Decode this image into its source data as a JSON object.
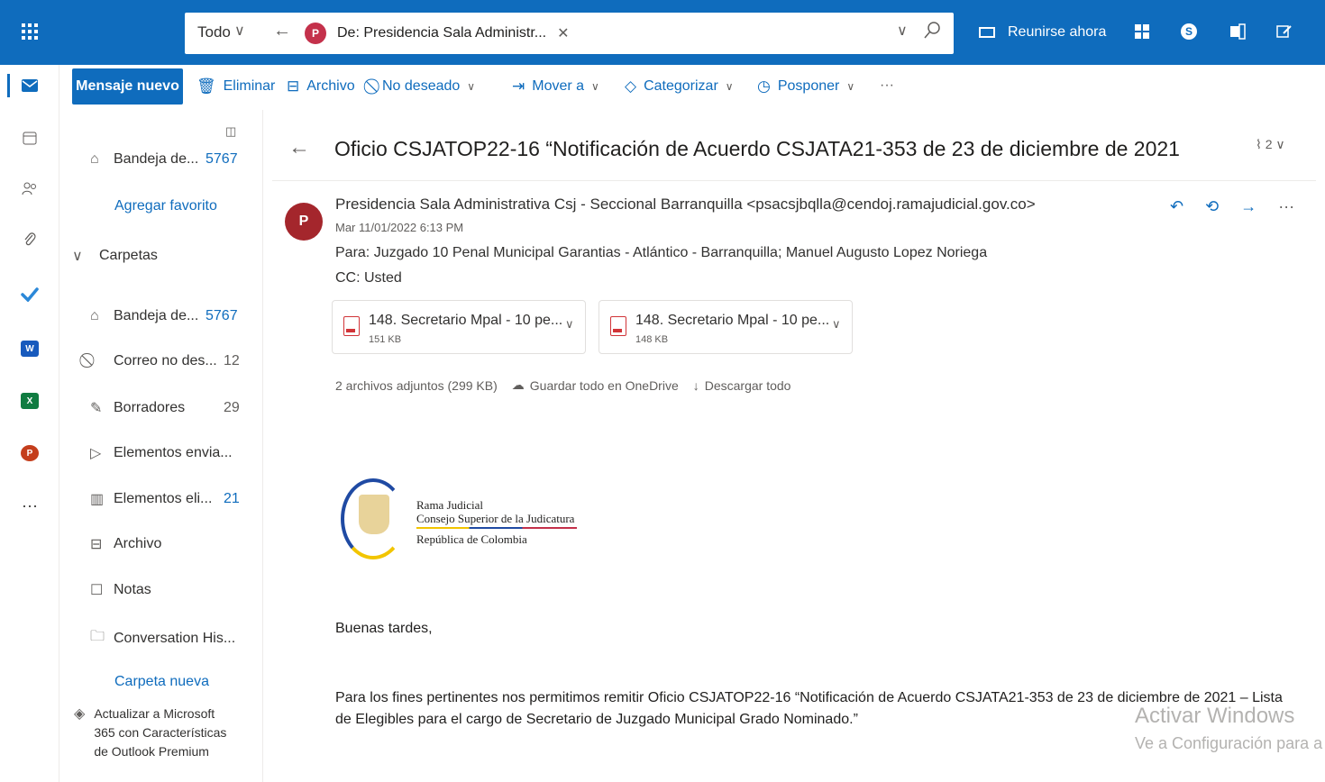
{
  "topbar": {
    "scope": "Todo",
    "chip_initial": "P",
    "chip_label": "De: Presidencia Sala Administr...",
    "meet_now": "Reunirse ahora",
    "accent": "#0f6cbd"
  },
  "commands": {
    "new_message": "Mensaje nuevo",
    "delete": "Eliminar",
    "archive": "Archivo",
    "junk": "No deseado",
    "move_to": "Mover a",
    "categorize": "Categorizar",
    "snooze": "Posponer",
    "more": "···"
  },
  "folders": {
    "favorite_inbox": {
      "label": "Bandeja de...",
      "count": "5767"
    },
    "add_favorite": "Agregar favorito",
    "folders_header": "Carpetas",
    "items": [
      {
        "label": "Bandeja de...",
        "count": "5767"
      },
      {
        "label": "Correo no des...",
        "count": "12"
      },
      {
        "label": "Borradores",
        "count": "29"
      },
      {
        "label": "Elementos envia...",
        "count": ""
      },
      {
        "label": "Elementos eli...",
        "count": "21"
      },
      {
        "label": "Archivo",
        "count": ""
      },
      {
        "label": "Notas",
        "count": ""
      },
      {
        "label": "Conversation His...",
        "count": ""
      }
    ],
    "new_folder": "Carpeta nueva",
    "upgrade": "Actualizar a Microsoft 365 con Características de Outlook Premium"
  },
  "message": {
    "subject": "Oficio CSJATOP22-16 “Notificación de Acuerdo CSJATA21-353 de 23 de diciembre de 2021",
    "attachment_count": "2",
    "sender_initial": "P",
    "from": "Presidencia Sala Administrativa Csj - Seccional Barranquilla <psacsjbqlla@cendoj.ramajudicial.gov.co>",
    "date": "Mar 11/01/2022 6:13 PM",
    "to": "Para: Juzgado 10 Penal Municipal Garantias - Atlántico - Barranquilla; Manuel Augusto Lopez Noriega",
    "cc": "CC: Usted",
    "attachments": [
      {
        "name": "148. Secretario Mpal - 10 pe...",
        "size": "151 KB"
      },
      {
        "name": "148. Secretario Mpal - 10 pe...",
        "size": "148 KB"
      }
    ],
    "attachments_summary": "2 archivos adjuntos (299 KB)",
    "save_onedrive": "Guardar todo en OneDrive",
    "download_all": "Descargar todo",
    "logo_line1": "Rama Judicial",
    "logo_line2": "Consejo Superior de la Judicatura",
    "logo_line3": "República de Colombia",
    "greeting": "Buenas tardes,",
    "paragraph_line1": "Para los fines pertinentes nos permitimos remitir Oficio CSJATOP22-16 “Notificación de Acuerdo CSJATA21-353 de 23 de diciembre de 2021 – Lista",
    "paragraph_line2": "de Elegibles para el cargo de Secretario de Juzgado Municipal Grado Nominado.”"
  },
  "watermark": {
    "line1": "Activar Windows",
    "line2": "Ve a Configuración para a"
  }
}
